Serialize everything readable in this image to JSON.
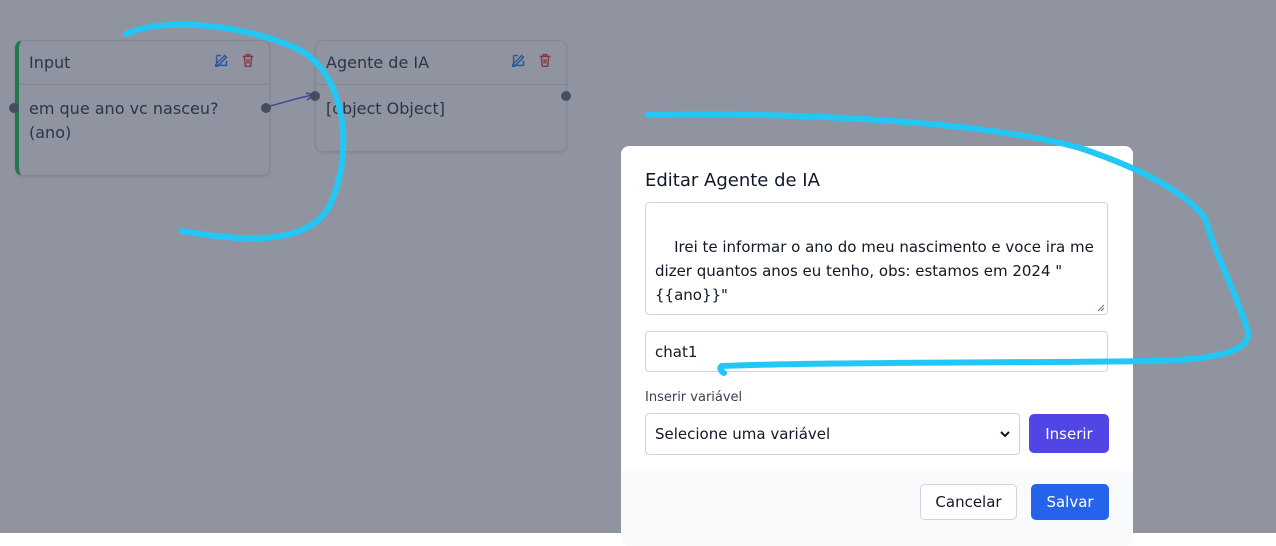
{
  "nodes": {
    "input": {
      "title": "Input",
      "body": "em que ano vc nasceu?\n(ano)"
    },
    "agent": {
      "title": "Agente de IA",
      "body": "[object Object]"
    }
  },
  "modal": {
    "title": "Editar Agente de IA",
    "prompt": "Irei te informar o ano do meu nascimento e voce ira me dizer quantos anos eu tenho, obs: estamos em 2024 \"{{ano}}\"",
    "name_value": "chat1",
    "variable_label": "Inserir variável",
    "variable_selected": "Selecione uma variável",
    "insert_label": "Inserir",
    "cancel_label": "Cancelar",
    "save_label": "Salvar"
  },
  "colors": {
    "primary": "#2563eb",
    "insert": "#4f46e5",
    "annotation": "#22c7f5",
    "delete": "#ef4444",
    "edit": "#3b82f6",
    "input_accent": "#22c55e"
  },
  "icons": {
    "edit": "edit-icon",
    "delete": "trash-icon"
  }
}
